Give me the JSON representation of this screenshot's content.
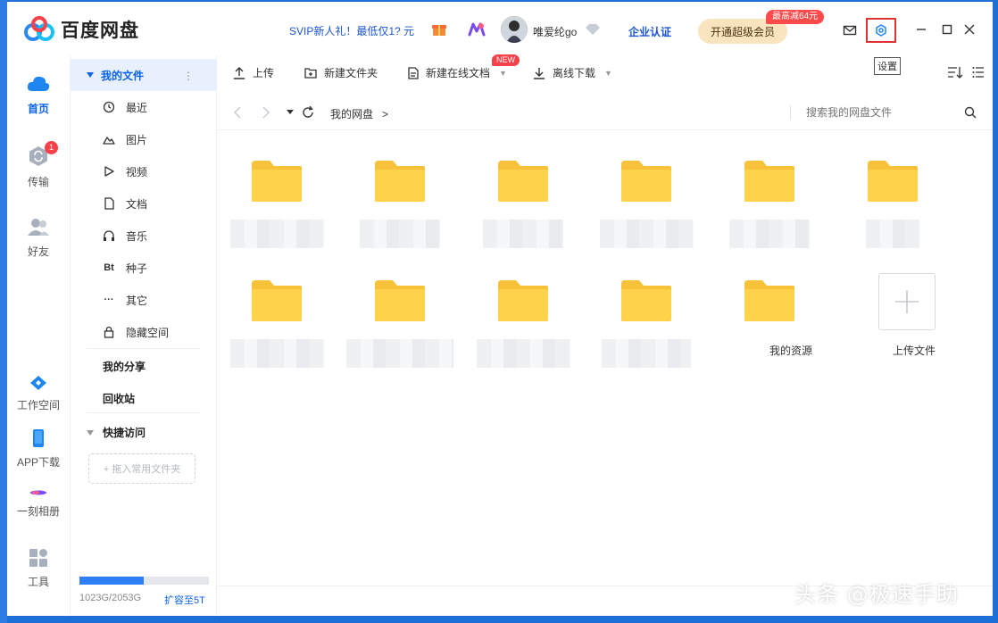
{
  "app": {
    "title": "百度网盘",
    "svip_promo": "SVIP新人礼！最低仅1? 元",
    "username": "唯爱纶go",
    "enterprise_label": "企业认证",
    "vip_button": "开通超级会员",
    "vip_badge": "最高减64元",
    "settings_tooltip": "设置",
    "accent_color": "#0b62e7",
    "folder_color": "#ffd24c"
  },
  "leftnav": {
    "items": [
      {
        "label": "首页",
        "icon": "cloud-icon",
        "active": true
      },
      {
        "label": "传输",
        "icon": "transfer-icon",
        "badge": "1"
      },
      {
        "label": "好友",
        "icon": "friends-icon"
      },
      {
        "label": "工作空间",
        "icon": "workspace-icon"
      },
      {
        "label": "APP下载",
        "icon": "phone-icon"
      },
      {
        "label": "一刻相册",
        "icon": "album-icon"
      },
      {
        "label": "工具",
        "icon": "tools-icon"
      }
    ]
  },
  "sidebar": {
    "my_files": "我的文件",
    "more": "⋮",
    "items": [
      {
        "label": "最近",
        "icon": "clock-icon"
      },
      {
        "label": "图片",
        "icon": "image-icon"
      },
      {
        "label": "视频",
        "icon": "video-icon"
      },
      {
        "label": "文档",
        "icon": "document-icon"
      },
      {
        "label": "音乐",
        "icon": "headphones-icon"
      },
      {
        "label": "种子",
        "icon": "bt-icon",
        "glyph": "Bt"
      },
      {
        "label": "其它",
        "icon": "more-icon",
        "glyph": "···"
      },
      {
        "label": "隐藏空间",
        "icon": "lock-icon"
      }
    ],
    "my_share": "我的分享",
    "recycle_bin": "回收站",
    "quick_access": "快捷访问",
    "drop_hint": "+ 拖入常用文件夹",
    "storage_text": "1023G/2053G",
    "storage_used_fraction": 0.498,
    "expand_link": "扩容至5T"
  },
  "toolbar": {
    "upload": "上传",
    "new_folder": "新建文件夹",
    "new_online_doc": "新建在线文档",
    "new_badge": "NEW",
    "offline_download": "离线下载"
  },
  "address": {
    "crumb": "我的网盘",
    "crumb_sep": ">",
    "search_placeholder": "搜索我的网盘文件"
  },
  "files": {
    "named_folder": "我的资源",
    "upload_tile": "上传文件"
  },
  "watermark": "头条 @极速手助"
}
